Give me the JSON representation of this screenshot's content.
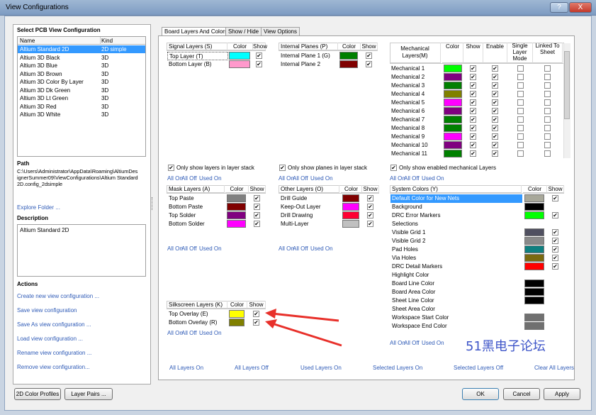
{
  "window": {
    "title": "View Configurations",
    "help_label": "?",
    "close_label": "X"
  },
  "left": {
    "select_title": "Select PCB View Configuration",
    "col_name": "Name",
    "col_kind": "Kind",
    "configs": [
      {
        "name": "Altium Standard 2D",
        "kind": "2D simple"
      },
      {
        "name": "Altium 3D Black",
        "kind": "3D"
      },
      {
        "name": "Altium 3D Blue",
        "kind": "3D"
      },
      {
        "name": "Altium 3D Brown",
        "kind": "3D"
      },
      {
        "name": "Altium 3D Color By Layer",
        "kind": "3D"
      },
      {
        "name": "Altium 3D Dk Green",
        "kind": "3D"
      },
      {
        "name": "Altium 3D Lt Green",
        "kind": "3D"
      },
      {
        "name": "Altium 3D Red",
        "kind": "3D"
      },
      {
        "name": "Altium 3D White",
        "kind": "3D"
      }
    ],
    "path_title": "Path",
    "path_line1": "C:\\Users\\Administrator\\AppData\\Roaming\\AltiumDes",
    "path_line2": "ignerSummer09\\ViewConfigurations\\Altium Standard",
    "path_line3": "2D.config_2dsimple",
    "explore": "Explore Folder ...",
    "description_title": "Description",
    "description": "Altium Standard 2D",
    "actions_title": "Actions",
    "actions": [
      "Create new view configuration ...",
      "Save view configuration",
      "Save As view configuration ...",
      "Load view configuration ...",
      "Rename view configuration ...",
      "Remove view configuration..."
    ]
  },
  "tabs": [
    "Board Layers And Colors",
    "Show / Hide",
    "View Options"
  ],
  "signal": {
    "h_name": "Signal Layers (S)",
    "h_color": "Color",
    "h_show": "Show",
    "rows": [
      {
        "name": "Top Layer (T)",
        "color": "#00ffff",
        "show": true
      },
      {
        "name": "Bottom Layer (B)",
        "color": "#ff99cc",
        "show": true
      }
    ],
    "only": "Only show layers in layer stack"
  },
  "planes": {
    "h_name": "Internal Planes (P)",
    "h_color": "Color",
    "h_show": "Show",
    "rows": [
      {
        "name": "Internal Plane 1 (G)",
        "color": "#008000",
        "show": true
      },
      {
        "name": "Internal Plane 2",
        "color": "#800000",
        "show": true
      }
    ],
    "only": "Only show planes in layer stack"
  },
  "mech": {
    "h_name": "Mechanical Layers(M)",
    "h_color": "Color",
    "h_show": "Show",
    "h_enable": "Enable",
    "h_single": "Single Layer Mode",
    "h_linked": "Linked To Sheet",
    "rows": [
      {
        "name": "Mechanical 1",
        "color": "#00ff00"
      },
      {
        "name": "Mechanical 2",
        "color": "#800080"
      },
      {
        "name": "Mechanical 3",
        "color": "#008000"
      },
      {
        "name": "Mechanical 4",
        "color": "#808000"
      },
      {
        "name": "Mechanical 5",
        "color": "#ff00ff"
      },
      {
        "name": "Mechanical 6",
        "color": "#800080"
      },
      {
        "name": "Mechanical 7",
        "color": "#008000"
      },
      {
        "name": "Mechanical 8",
        "color": "#008000"
      },
      {
        "name": "Mechanical 9",
        "color": "#ff00ff"
      },
      {
        "name": "Mechanical 10",
        "color": "#800080"
      },
      {
        "name": "Mechanical 11",
        "color": "#008000"
      }
    ],
    "only": "Only show enabled mechanical Layers"
  },
  "links": {
    "all_on": "All On",
    "all_off": "All Off",
    "used_on": "Used On"
  },
  "mask": {
    "h_name": "Mask Layers (A)",
    "h_color": "Color",
    "h_show": "Show",
    "rows": [
      {
        "name": "Top Paste",
        "color": "#808080"
      },
      {
        "name": "Bottom Paste",
        "color": "#800000"
      },
      {
        "name": "Top Solder",
        "color": "#800080"
      },
      {
        "name": "Bottom Solder",
        "color": "#ff00ff"
      }
    ]
  },
  "other": {
    "h_name": "Other Layers (O)",
    "h_color": "Color",
    "h_show": "Show",
    "rows": [
      {
        "name": "Drill Guide",
        "color": "#800000"
      },
      {
        "name": "Keep-Out Layer",
        "color": "#ff00ff"
      },
      {
        "name": "Drill Drawing",
        "color": "#ff0033"
      },
      {
        "name": "Multi-Layer",
        "color": "#c0c0c0"
      }
    ]
  },
  "system": {
    "h_name": "System Colors (Y)",
    "h_color": "Color",
    "h_show": "Show",
    "rows": [
      {
        "name": "Default Color for New Nets",
        "color": "#a8a89a",
        "show": true
      },
      {
        "name": "Background",
        "color": "#000000",
        "show": null
      },
      {
        "name": "DRC Error Markers",
        "color": "#00ff00",
        "show": true
      },
      {
        "name": "Selections",
        "color": "",
        "show": null
      },
      {
        "name": "Visible Grid 1",
        "color": "#505060",
        "show": true
      },
      {
        "name": "Visible Grid 2",
        "color": "#8a8a8a",
        "show": true
      },
      {
        "name": "Pad Holes",
        "color": "#0f8080",
        "show": true
      },
      {
        "name": "Via Holes",
        "color": "#7a6a10",
        "show": true
      },
      {
        "name": "DRC Detail Markers",
        "color": "#ff0000",
        "show": true
      },
      {
        "name": "Highlight Color",
        "color": "",
        "show": null
      },
      {
        "name": "Board Line Color",
        "color": "#000000",
        "show": null
      },
      {
        "name": "Board Area Color",
        "color": "#000000",
        "show": null
      },
      {
        "name": "Sheet Line Color",
        "color": "#000000",
        "show": null
      },
      {
        "name": "Sheet Area Color",
        "color": "",
        "show": null
      },
      {
        "name": "Workspace Start Color",
        "color": "#707070",
        "show": null
      },
      {
        "name": "Workspace End Color",
        "color": "#707070",
        "show": null
      }
    ]
  },
  "silk": {
    "h_name": "Silkscreen Layers (K)",
    "h_color": "Color",
    "h_show": "Show",
    "rows": [
      {
        "name": "Top Overlay (E)",
        "color": "#ffff00"
      },
      {
        "name": "Bottom Overlay (R)",
        "color": "#808000"
      }
    ]
  },
  "watermark": "51黑电子论坛",
  "bottom_links": [
    "All Layers On",
    "All Layers Off",
    "Used Layers On",
    "Selected Layers On",
    "Selected Layers Off",
    "Clear All Layers"
  ],
  "footer": {
    "color_profiles": "2D Color Profiles",
    "layer_pairs": "Layer Pairs ...",
    "ok": "OK",
    "cancel": "Cancel",
    "apply": "Apply"
  },
  "check": "✔",
  "colors": {
    "link": "#2f5bb7",
    "selection": "#3399ff",
    "arrow": "#e8302a"
  }
}
